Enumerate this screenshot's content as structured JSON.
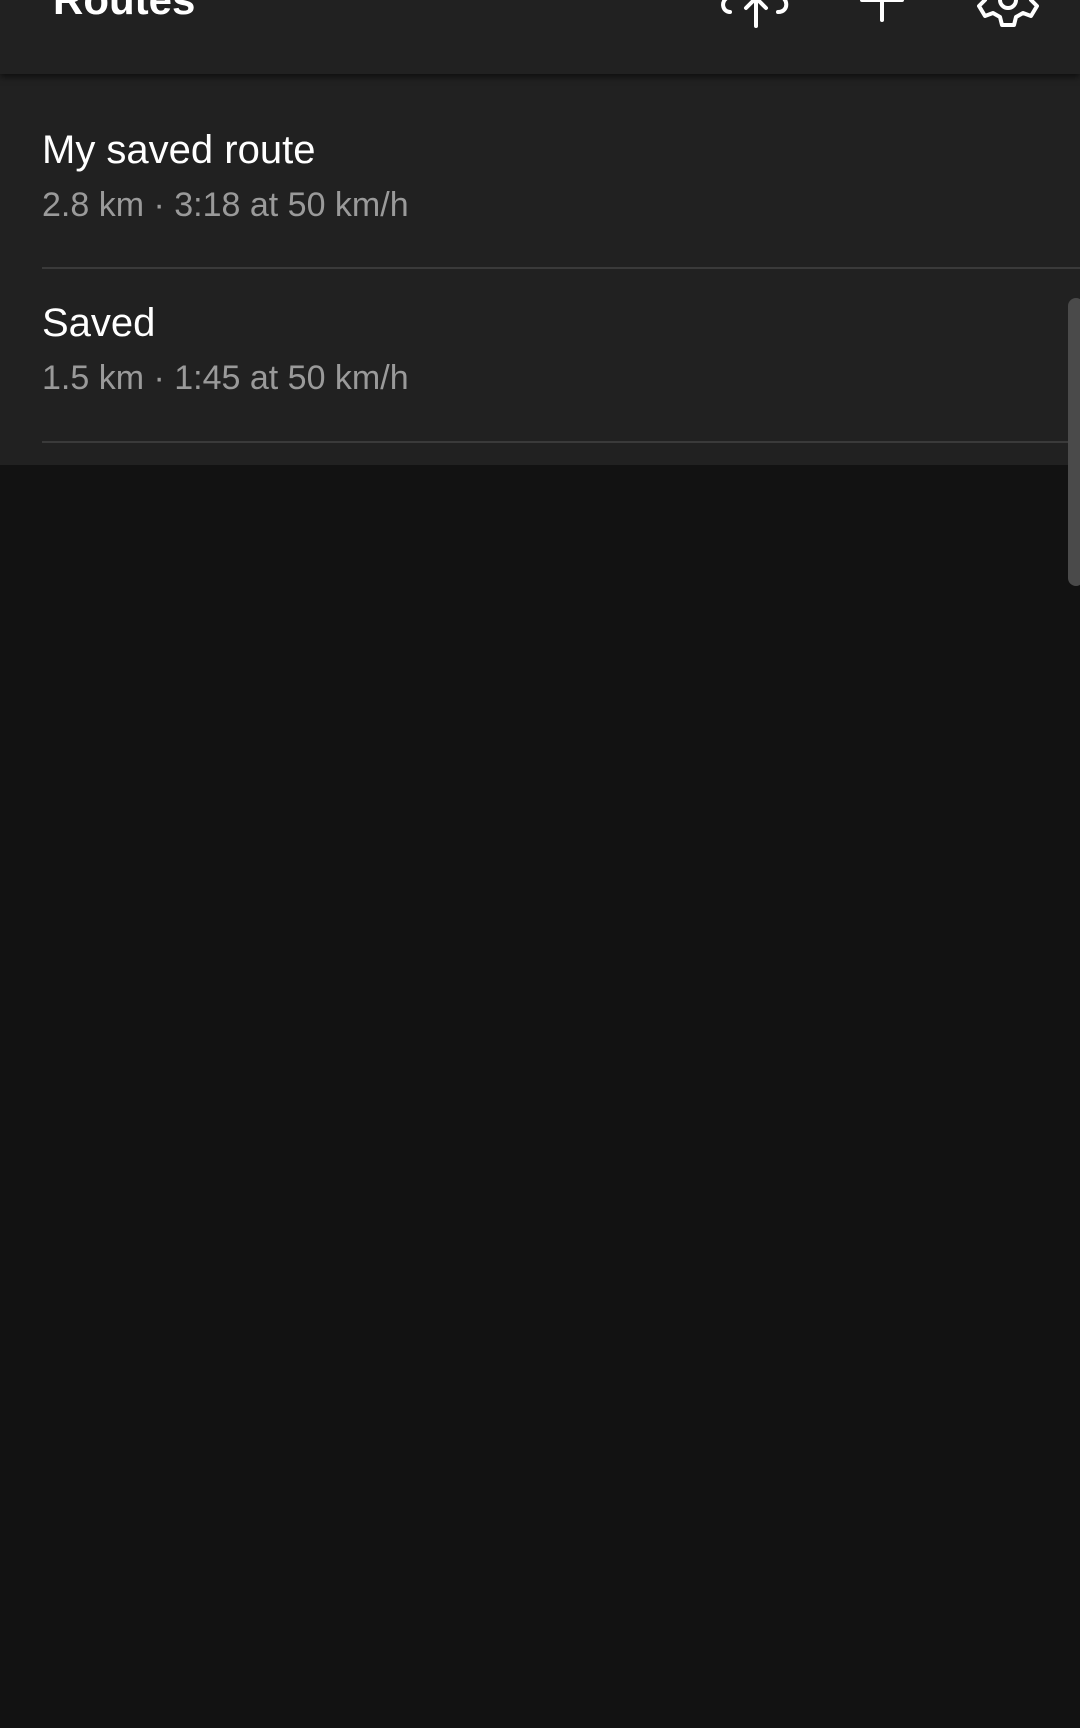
{
  "app_bar": {
    "title": "Routes",
    "actions": [
      {
        "name": "upload-icon"
      },
      {
        "name": "add-icon"
      },
      {
        "name": "gear-icon"
      }
    ]
  },
  "routes": [
    {
      "name": "My saved route",
      "meta": "2.8 km · 3:18 at 50 km/h"
    },
    {
      "name": "Saved",
      "meta": "1.5 km · 1:45 at 50 km/h"
    }
  ],
  "colors": {
    "background": "#121212",
    "surface": "#212121",
    "primary_text": "#ffffff",
    "secondary_text": "#9a9a9a",
    "divider": "#3a3a3a"
  }
}
